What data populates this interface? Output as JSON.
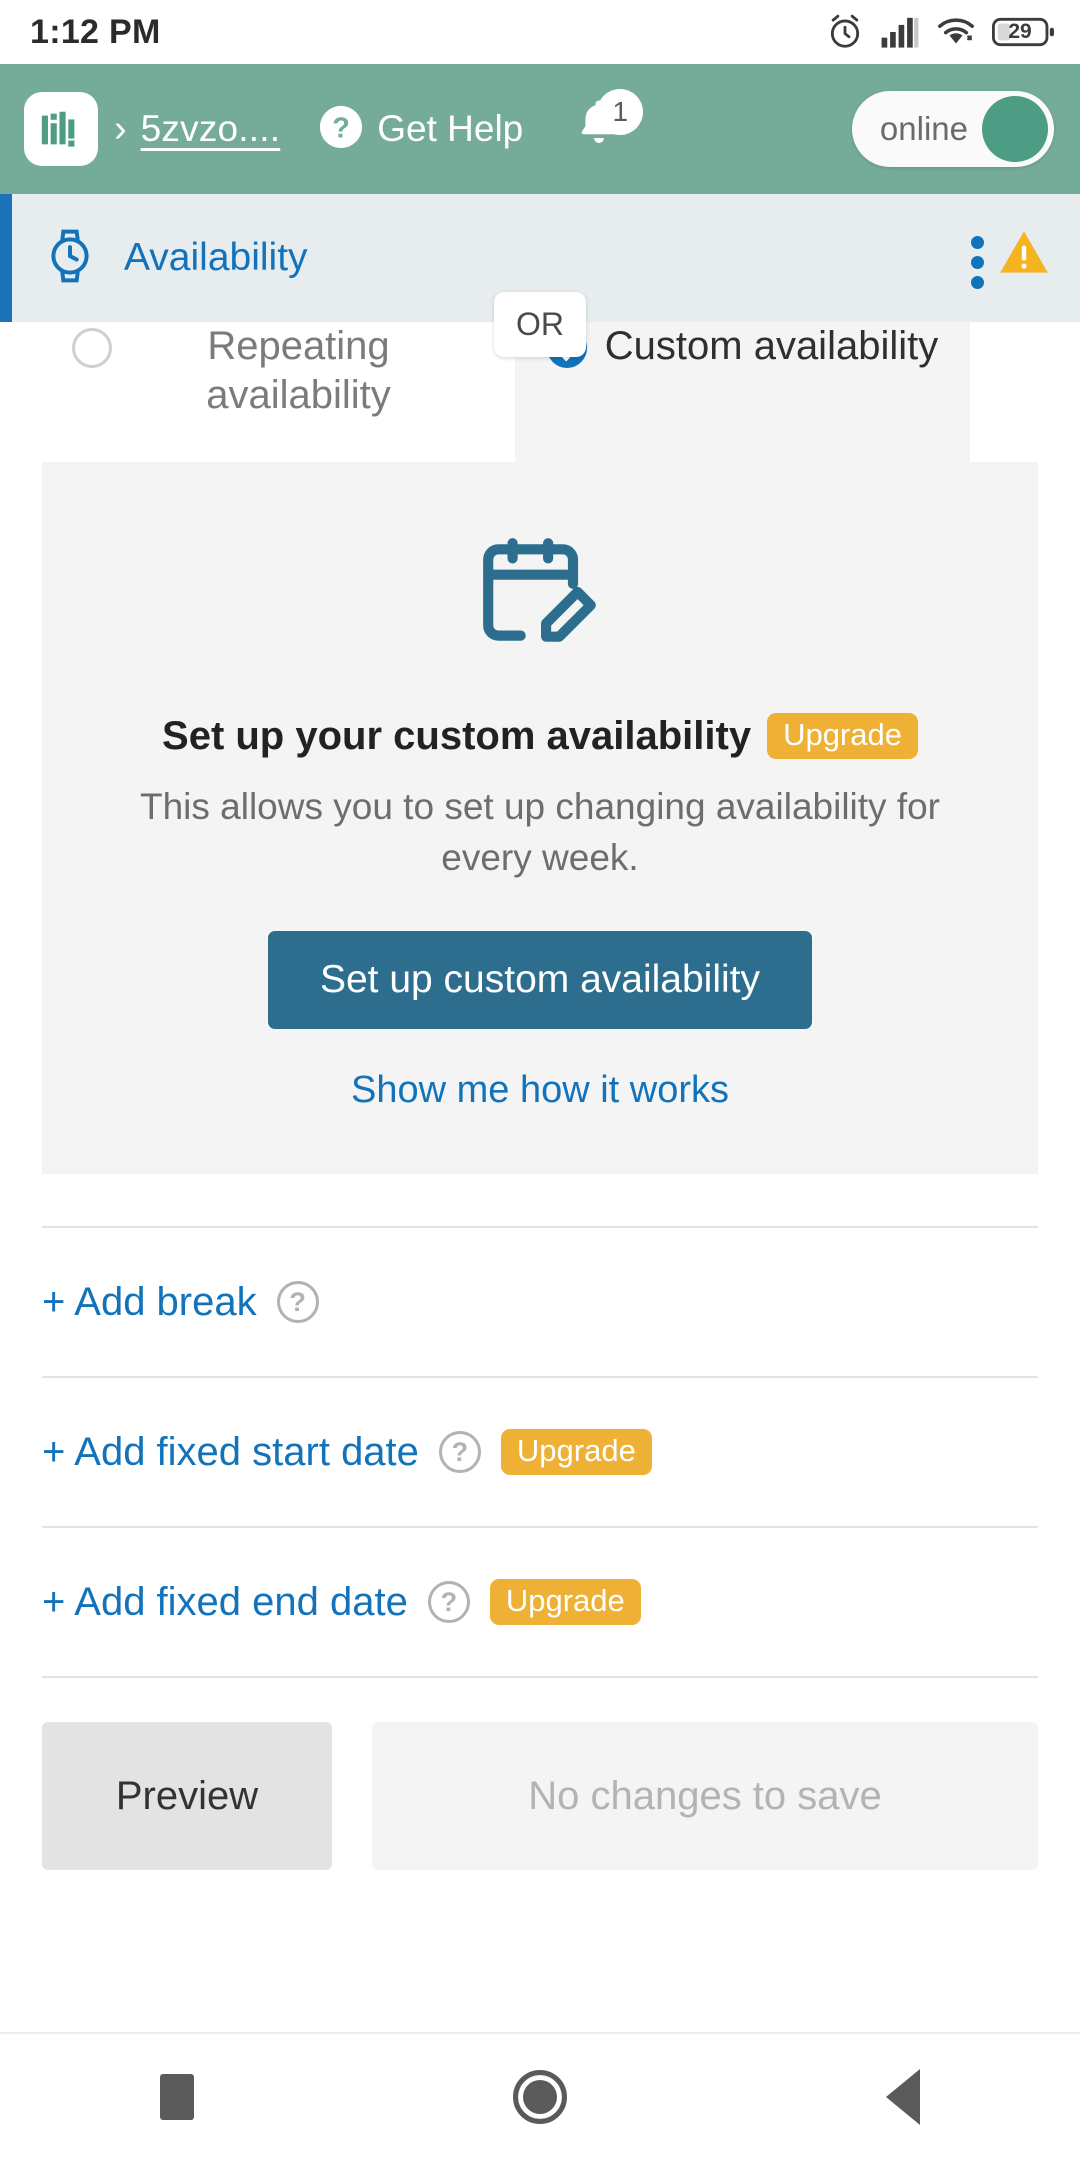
{
  "statusbar": {
    "time": "1:12 PM",
    "battery_percent": "29",
    "icons": [
      "alarm-clock-icon",
      "cellular-signal-icon",
      "wifi-icon",
      "battery-icon"
    ]
  },
  "appbar": {
    "logo_icon": "app-logo-bars-icon",
    "breadcrumb_separator": "›",
    "breadcrumb_link": "5zvzo....",
    "help_icon": "question-circle-icon",
    "help_label": "Get Help",
    "bell_icon": "bell-icon",
    "bell_badge": "1",
    "toggle_label": "online",
    "brand_green": "#74ab99"
  },
  "section": {
    "icon": "watch-clock-icon",
    "title": "Availability",
    "menu_icon": "kebab-menu-icon",
    "warning_icon": "warning-triangle-icon",
    "accent_blue": "#1273ba",
    "warning_color": "#f5b320"
  },
  "availability_choice": {
    "left": {
      "label": "Repeating availability",
      "selected": false
    },
    "or_label": "OR",
    "right": {
      "label": "Custom availability",
      "selected": true
    }
  },
  "panel": {
    "icon": "calendar-edit-icon",
    "title": "Set up your custom availability",
    "badge": "Upgrade",
    "description": "This allows you to set up changing availability for every week.",
    "cta_label": "Set up custom availability",
    "link_label": "Show me how it works",
    "cta_color": "#2d6e8f",
    "badge_color": "#eeb035"
  },
  "options": [
    {
      "label": "+ Add break",
      "help_icon": "question-circle-outline-icon",
      "badge": null
    },
    {
      "label": "+ Add fixed start date",
      "help_icon": "question-circle-outline-icon",
      "badge": "Upgrade"
    },
    {
      "label": "+ Add fixed end date",
      "help_icon": "question-circle-outline-icon",
      "badge": "Upgrade"
    }
  ],
  "footer": {
    "preview_label": "Preview",
    "save_label": "No changes to save"
  },
  "navbar": {
    "recents_icon": "square-recents-icon",
    "home_icon": "circle-home-icon",
    "back_icon": "triangle-back-icon"
  }
}
